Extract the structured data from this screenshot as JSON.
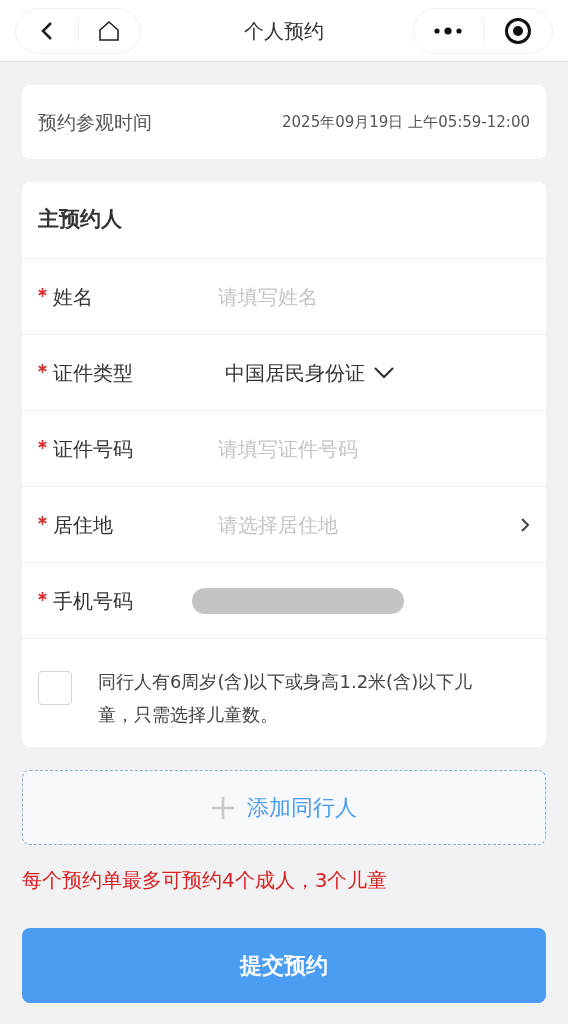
{
  "nav": {
    "title": "个人预约"
  },
  "visit_time": {
    "label": "预约参观时间",
    "value": "2025年09月19日 上午05:59-12:00"
  },
  "main_person": {
    "title": "主预约人",
    "fields": [
      {
        "kind": "input",
        "required": true,
        "label": "姓名",
        "placeholder": "请填写姓名"
      },
      {
        "kind": "select",
        "required": true,
        "label": "证件类型",
        "value": "中国居民身份证"
      },
      {
        "kind": "input",
        "required": true,
        "label": "证件号码",
        "placeholder": "请填写证件号码"
      },
      {
        "kind": "picker",
        "required": true,
        "label": "居住地",
        "placeholder": "请选择居住地"
      },
      {
        "kind": "redacted",
        "required": true,
        "label": "手机号码"
      }
    ],
    "child_option": {
      "checked": false,
      "text": "同行人有6周岁(含)以下或身高1.2米(含)以下儿童，只需选择儿童数。"
    }
  },
  "add_companion": {
    "label": "添加同行人"
  },
  "notice": "每个预约单最多可预约4个成人，3个儿童",
  "submit": {
    "label": "提交预约"
  }
}
